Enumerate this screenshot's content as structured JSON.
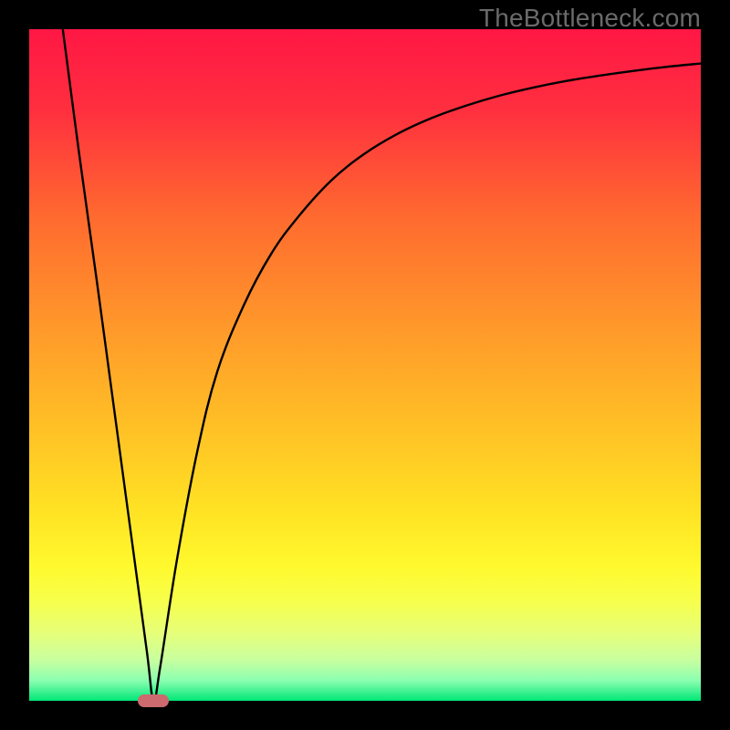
{
  "watermark": "TheBottleneck.com",
  "chart_data": {
    "type": "line",
    "title": "",
    "xlabel": "",
    "ylabel": "",
    "xlim": [
      0,
      100
    ],
    "ylim": [
      0,
      100
    ],
    "grid": false,
    "legend": false,
    "background_gradient_stops": [
      {
        "pct": 0,
        "color": "#ff1744"
      },
      {
        "pct": 12,
        "color": "#ff2f3f"
      },
      {
        "pct": 28,
        "color": "#ff6a2f"
      },
      {
        "pct": 45,
        "color": "#ff9a2a"
      },
      {
        "pct": 60,
        "color": "#ffc225"
      },
      {
        "pct": 72,
        "color": "#ffe324"
      },
      {
        "pct": 80,
        "color": "#fff92e"
      },
      {
        "pct": 85,
        "color": "#f7ff4a"
      },
      {
        "pct": 90,
        "color": "#e6ff7a"
      },
      {
        "pct": 94,
        "color": "#c7ffa0"
      },
      {
        "pct": 97,
        "color": "#8affb0"
      },
      {
        "pct": 100,
        "color": "#00e676"
      }
    ],
    "series": [
      {
        "name": "curve",
        "color": "#000000",
        "x": [
          5,
          7.5,
          10,
          12.5,
          15,
          17.5,
          18.5,
          19.5,
          22,
          25,
          28,
          32,
          36,
          40,
          45,
          50,
          55,
          60,
          65,
          70,
          75,
          80,
          85,
          90,
          95,
          100
        ],
        "y": [
          100,
          81,
          63,
          44.5,
          26,
          7.5,
          0,
          5,
          21,
          37,
          49,
          59,
          66.5,
          72,
          77.5,
          81.5,
          84.5,
          86.8,
          88.6,
          90.1,
          91.3,
          92.3,
          93.1,
          93.8,
          94.4,
          94.9
        ]
      }
    ],
    "marker": {
      "x": 18.5,
      "y": 0,
      "color": "#cc6a70"
    }
  }
}
